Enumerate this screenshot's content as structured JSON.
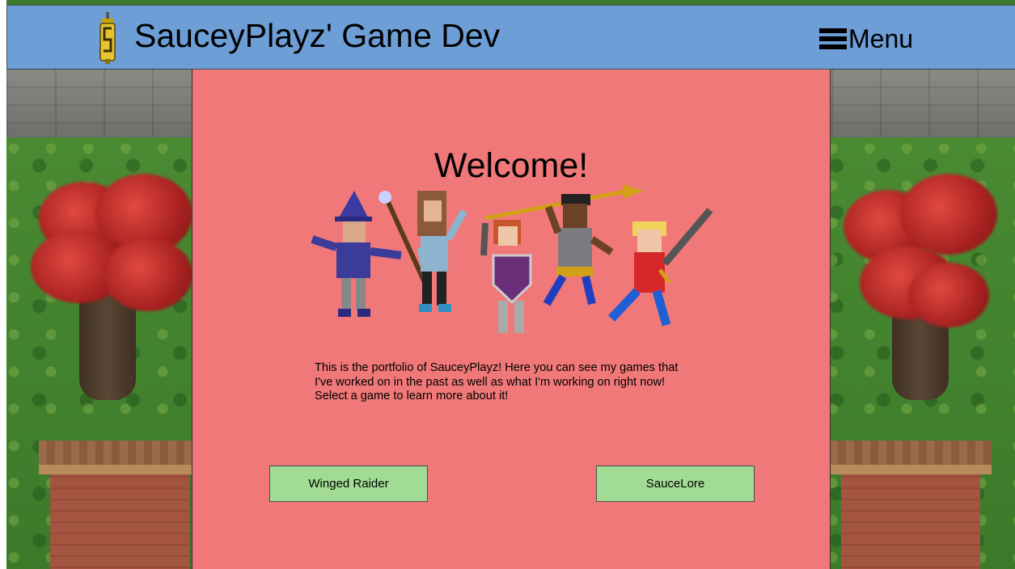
{
  "header": {
    "title": "SauceyPlayz' Game Dev",
    "logo_icon": "sword-s-logo-icon",
    "menu_icon": "hamburger-icon",
    "menu_label": "Menu"
  },
  "main": {
    "heading": "Welcome!",
    "hero_image": "pixel-art-party-of-five-heroes",
    "intro": "This is the portfolio of SauceyPlayz! Here you can see my games that I've worked on in the past as well as what I'm working on right now! Select a game to learn more about it!",
    "games": [
      {
        "label": "Winged Raider"
      },
      {
        "label": "SauceLore"
      }
    ]
  },
  "colors": {
    "header_bg": "#6d9ed6",
    "panel_bg": "#f07878",
    "button_bg": "#a2dc94"
  }
}
